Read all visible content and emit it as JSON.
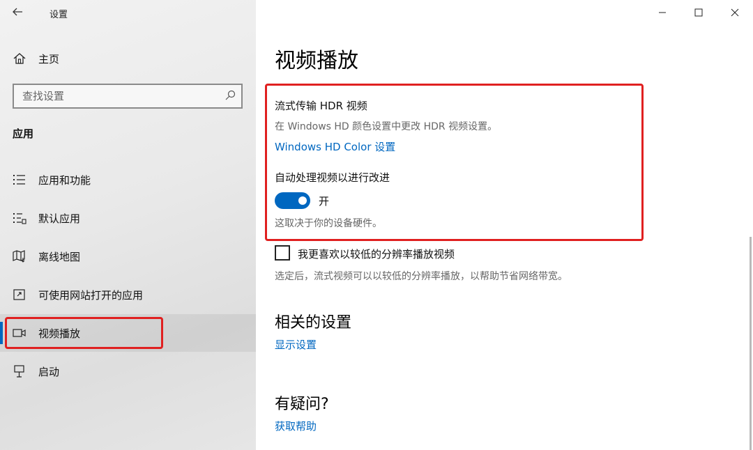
{
  "window": {
    "title": "设置"
  },
  "sidebar": {
    "home_label": "主页",
    "search_placeholder": "查找设置",
    "section_label": "应用",
    "items": [
      {
        "label": "应用和功能",
        "icon": "list-icon"
      },
      {
        "label": "默认应用",
        "icon": "default-apps-icon"
      },
      {
        "label": "离线地图",
        "icon": "map-icon"
      },
      {
        "label": "可使用网站打开的应用",
        "icon": "open-external-icon"
      },
      {
        "label": "视频播放",
        "icon": "video-icon",
        "active": true
      },
      {
        "label": "启动",
        "icon": "startup-icon"
      }
    ]
  },
  "main": {
    "title": "视频播放",
    "hdr": {
      "heading": "流式传输 HDR 视频",
      "description": "在 Windows HD 颜色设置中更改 HDR 视频设置。",
      "link": "Windows HD Color 设置"
    },
    "auto_process": {
      "heading": "自动处理视频以进行改进",
      "toggle_state": "开",
      "note": "这取决于你的设备硬件。"
    },
    "low_resolution": {
      "checkbox_label": "我更喜欢以较低的分辨率播放视频",
      "description": "选定后，流式视频可以以较低的分辨率播放，以帮助节省网络带宽。"
    },
    "related": {
      "heading": "相关的设置",
      "link": "显示设置"
    },
    "help": {
      "heading": "有疑问?",
      "link": "获取帮助"
    }
  },
  "colors": {
    "accent": "#0067c0",
    "highlight": "#e02020"
  }
}
